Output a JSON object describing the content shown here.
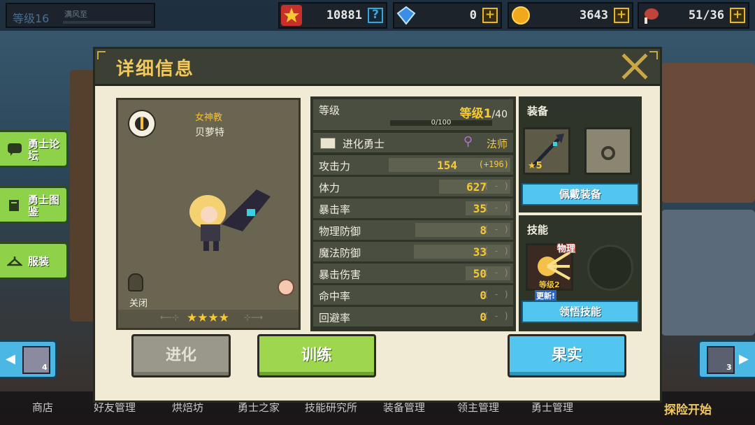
{
  "topbar": {
    "level_label": "等级16",
    "player_name": "满风至",
    "resources": [
      {
        "icon": "trophy-icon",
        "value": "10881",
        "action": "?"
      },
      {
        "icon": "diamond-icon",
        "value": "0",
        "action": "+"
      },
      {
        "icon": "gold-coin-icon",
        "value": "3643",
        "action": "+"
      },
      {
        "icon": "meat-icon",
        "value": "51/36",
        "action": "+"
      }
    ]
  },
  "side_buttons": [
    {
      "label": "勇士论坛",
      "icon": "chat-icon"
    },
    {
      "label": "勇士图鉴",
      "icon": "book-icon"
    },
    {
      "label": "服装",
      "icon": "hanger-icon"
    }
  ],
  "left_nav": {
    "stars": "4"
  },
  "right_nav": {
    "stars": "3"
  },
  "bottom_nav": [
    "商店",
    "好友管理",
    "烘焙坊",
    "勇士之家",
    "技能研究所",
    "装备管理",
    "领主管理",
    "勇士管理",
    "探险开始"
  ],
  "dialog": {
    "title": "详细信息",
    "close_label": "X",
    "hero": {
      "class_name": "女神教",
      "hero_name": "贝萝特",
      "lock_label": "关闭",
      "stars": "★★★★"
    },
    "stats": {
      "level_label": "等级",
      "level_value": "等级1",
      "level_max": "/40",
      "xp_text": "0/100",
      "evolution_label": "进化勇士",
      "class_label": "法师",
      "rows": [
        {
          "label": "攻击力",
          "value": "154",
          "bonus": "(+196)",
          "fill": 0.82
        },
        {
          "label": "体力",
          "value": "627",
          "bonus": "( - )",
          "fill": 0.48
        },
        {
          "label": "暴击率",
          "value": "35",
          "bonus": "( - )",
          "fill": 0.3
        },
        {
          "label": "物理防御",
          "value": "8",
          "bonus": "( - )",
          "fill": 0.64
        },
        {
          "label": "魔法防御",
          "value": "33",
          "bonus": "( - )",
          "fill": 0.65
        },
        {
          "label": "暴击伤害",
          "value": "50",
          "bonus": "( - )",
          "fill": 0.3
        },
        {
          "label": "命中率",
          "value": "0",
          "bonus": "( - )",
          "fill": 0.0
        },
        {
          "label": "回避率",
          "value": "0",
          "bonus": "( - )",
          "fill": 0.0
        }
      ]
    },
    "equipment": {
      "title": "装备",
      "weapon_stars": "★5",
      "equip_button": "佩戴装备"
    },
    "skills": {
      "title": "技能",
      "skill_tag": "物理",
      "skill_level": "等级2",
      "new_tag": "更新!",
      "learn_button": "领悟技能"
    },
    "actions": {
      "evolve": "进化",
      "train": "训练",
      "fruit": "果实"
    }
  }
}
